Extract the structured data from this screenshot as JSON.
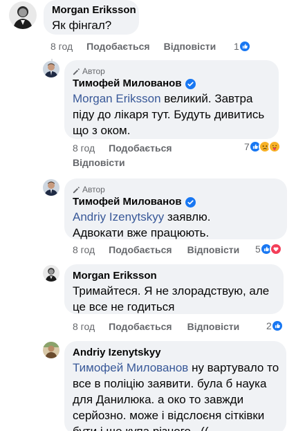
{
  "comments": [
    {
      "author": "Morgan Eriksson",
      "text": "Як фінгал?",
      "time": "8 год",
      "like_label": "Подобається",
      "reply_label": "Відповісти",
      "reaction_count": "1",
      "reactions": [
        "like-icon"
      ]
    },
    {
      "author_tag": "Автор",
      "author": "Тимофей Милованов",
      "verified": true,
      "mention": "Morgan Eriksson",
      "text": "великий. Завтра піду до лікаря тут. Будуть дивитись що з оком.",
      "time": "8 год",
      "like_label": "Подобається",
      "reply_label": "Відповісти",
      "reaction_count": "7",
      "reactions": [
        "like-icon",
        "sad-icon",
        "care-icon"
      ]
    },
    {
      "author_tag": "Автор",
      "author": "Тимофей Милованов",
      "verified": true,
      "mention": "Andriy Izenytskyy",
      "text": "заявлю. Адвокати вже працюють.",
      "time": "8 год",
      "like_label": "Подобається",
      "reply_label": "Відповісти",
      "reaction_count": "5",
      "reactions": [
        "like-icon",
        "love-icon"
      ]
    },
    {
      "author": "Morgan Eriksson",
      "text": "Тримайтеся. Я не злорадствую, але це все не годиться",
      "time": "8 год",
      "like_label": "Подобається",
      "reply_label": "Відповісти",
      "reaction_count": "2",
      "reactions": [
        "like-icon"
      ]
    },
    {
      "author": "Andriy Izenytskyy",
      "mention": "Тимофей Милованов",
      "text": "ну вартувало то все в поліцію заявити. була б наука для Данилюка. а око то завжди серйозно. може і відслоєня сітківки бути і ще купа різного...(("
    }
  ],
  "colors": {
    "bubble": "#f0f2f5",
    "mention": "#385898",
    "meta": "#65676b",
    "like_blue": "#1877f2",
    "love_red": "#f33e58",
    "sad_yellow": "#f7b125"
  }
}
